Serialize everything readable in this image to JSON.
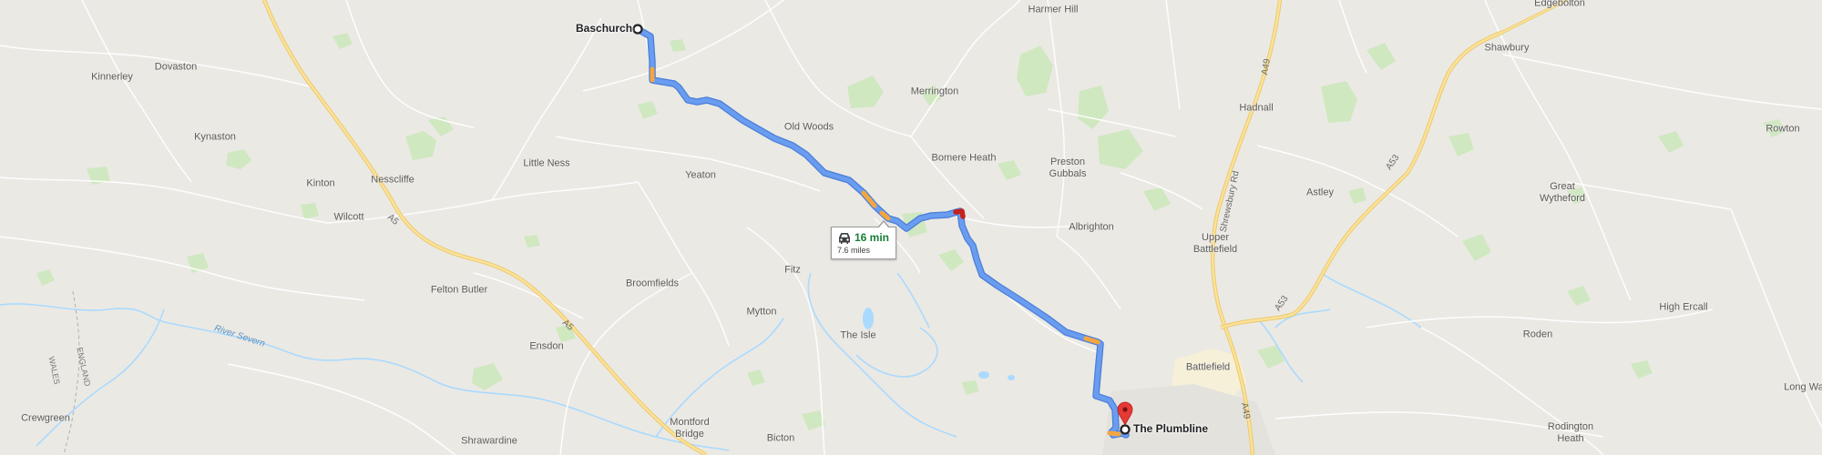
{
  "map": {
    "type": "road-map",
    "colors": {
      "land": "#ebe9e4",
      "park": "#c8e6b8",
      "water": "#aadaff",
      "major_road": "#f6cf63",
      "minor_road": "#ffffff",
      "route": "#6a9cf0",
      "route_slow": "#f4a640",
      "route_jam": "#c5221f",
      "destination_pin": "#e53935"
    }
  },
  "places": [
    {
      "name": "Kinnerley"
    },
    {
      "name": "Dovaston"
    },
    {
      "name": "Kynaston"
    },
    {
      "name": "Kinton"
    },
    {
      "name": "Nesscliffe"
    },
    {
      "name": "Wilcott"
    },
    {
      "name": "Felton Butler"
    },
    {
      "name": "Ensdon"
    },
    {
      "name": "Crewgreen"
    },
    {
      "name": "Shrawardine"
    },
    {
      "name": "Little Ness"
    },
    {
      "name": "Yeaton"
    },
    {
      "name": "Broomfields"
    },
    {
      "name": "Fitz"
    },
    {
      "name": "Mytton"
    },
    {
      "name": "The Isle"
    },
    {
      "name": "Montford\nBridge"
    },
    {
      "name": "Bicton"
    },
    {
      "name": "Old Woods"
    },
    {
      "name": "Merrington"
    },
    {
      "name": "Bomere Heath"
    },
    {
      "name": "Harmer Hill"
    },
    {
      "name": "Preston\nGubbals"
    },
    {
      "name": "Albrighton"
    },
    {
      "name": "Battlefield"
    },
    {
      "name": "Upper\nBattlefield"
    },
    {
      "name": "Hadnall"
    },
    {
      "name": "Astley"
    },
    {
      "name": "Edgebolton"
    },
    {
      "name": "Shawbury"
    },
    {
      "name": "Great\nWytheford"
    },
    {
      "name": "Rowton"
    },
    {
      "name": "High Ercall"
    },
    {
      "name": "Roden"
    },
    {
      "name": "Rodington\nHeath"
    },
    {
      "name": "Long Wa"
    }
  ],
  "road_labels": [
    {
      "text": "A5"
    },
    {
      "text": "A5"
    },
    {
      "text": "A49"
    },
    {
      "text": "A49"
    },
    {
      "text": "A53"
    },
    {
      "text": "A53"
    },
    {
      "text": "Shrewsbury Rd"
    },
    {
      "text": "River Severn"
    },
    {
      "text": "ENGLAND"
    },
    {
      "text": "WALES"
    }
  ],
  "route": {
    "origin": "Baschurch",
    "destination": "The Plumbline",
    "duration": "16 min",
    "distance": "7.6 miles",
    "mode_icon": "car-icon"
  }
}
